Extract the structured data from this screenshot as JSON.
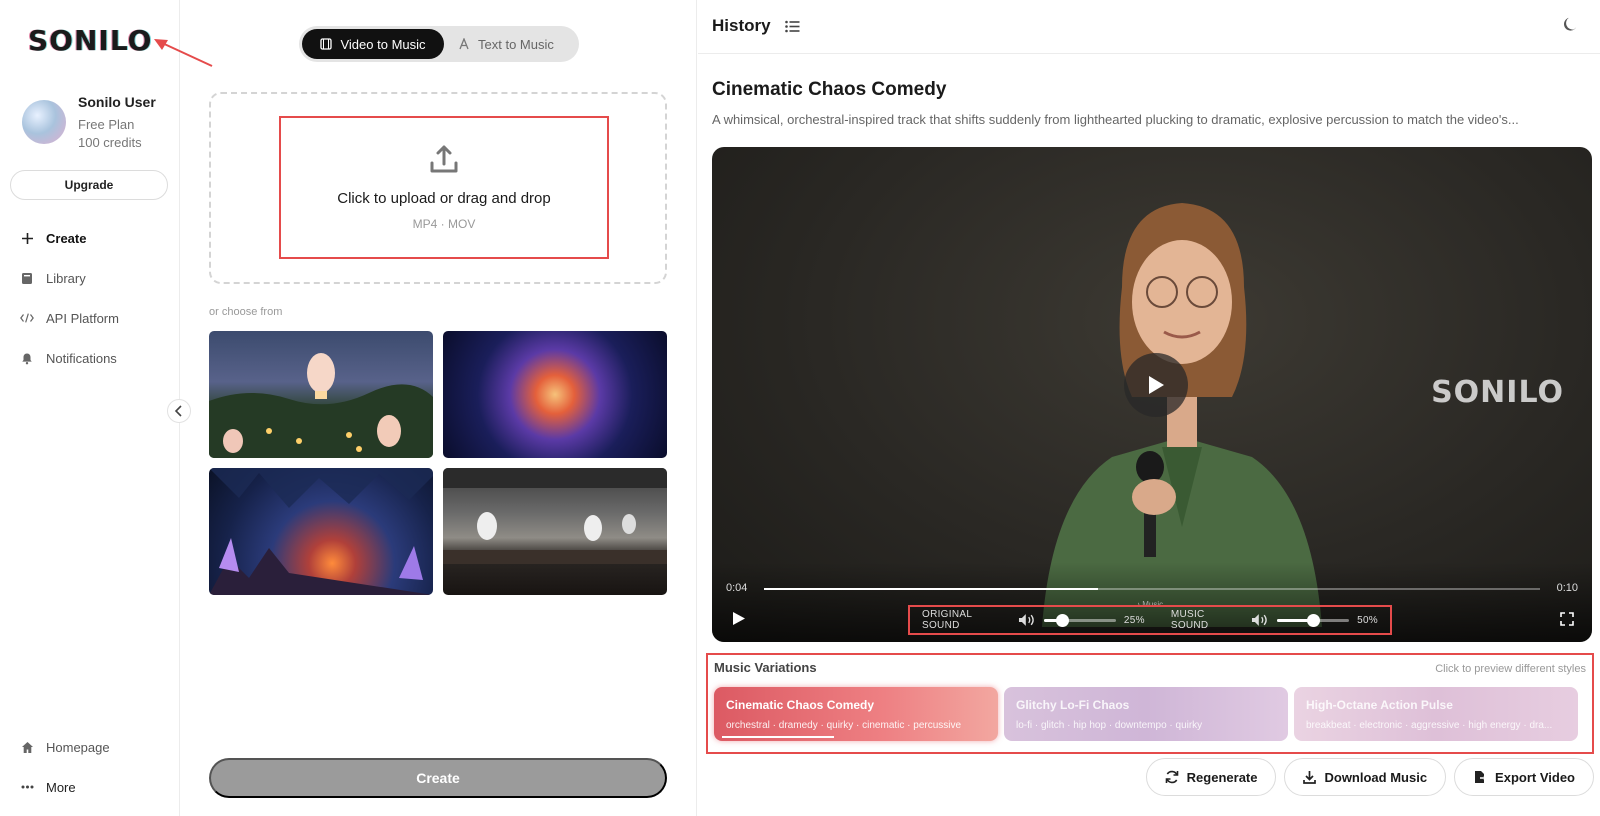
{
  "brand": {
    "logo_text": "SONILO",
    "accent": "#e54b4b"
  },
  "user": {
    "name": "Sonilo User",
    "plan": "Free Plan",
    "credits": "100 credits"
  },
  "sidebar": {
    "upgrade_label": "Upgrade",
    "items": [
      {
        "label": "Create",
        "icon": "plus-icon"
      },
      {
        "label": "Library",
        "icon": "book-icon"
      },
      {
        "label": "API Platform",
        "icon": "code-icon"
      },
      {
        "label": "Notifications",
        "icon": "bell-icon"
      }
    ],
    "bottom_items": [
      {
        "label": "Homepage",
        "icon": "home-icon"
      },
      {
        "label": "More",
        "icon": "more-icon"
      }
    ]
  },
  "composer": {
    "modes": [
      {
        "label": "Video to Music",
        "icon": "film-icon",
        "active": true
      },
      {
        "label": "Text to Music",
        "icon": "text-icon",
        "active": false
      }
    ],
    "upload_title": "Click to upload or drag and drop",
    "upload_formats": "MP4 · MOV",
    "choose_label": "or choose from",
    "samples": [
      "lanterns-thumbnail",
      "nebula-thumbnail",
      "crystal-cave-thumbnail",
      "kitchen-thumbnail"
    ],
    "create_label": "Create"
  },
  "history": {
    "title": "History",
    "track_title": "Cinematic Chaos Comedy",
    "track_desc": "A whimsical, orchestral-inspired track that shifts suddenly from lighthearted plucking to dramatic, explosive percussion to match the video's...",
    "video": {
      "watermark": "SONILO",
      "current_time": "0:04",
      "end_time": "0:10",
      "progress": 0.43,
      "music_tag": "♪ Music",
      "original_sound_label": "ORIGINAL SOUND",
      "original_sound_value": "25%",
      "original_sound_level": 0.25,
      "music_sound_label": "MUSIC SOUND",
      "music_sound_value": "50%",
      "music_sound_level": 0.5
    },
    "variations": {
      "label": "Music Variations",
      "hint": "Click to preview different styles",
      "items": [
        {
          "title": "Cinematic Chaos Comedy",
          "tags": "orchestral · dramedy · quirky · cinematic · percussive"
        },
        {
          "title": "Glitchy Lo-Fi Chaos",
          "tags": "lo-fi · glitch · hip hop · downtempo · quirky"
        },
        {
          "title": "High-Octane Action Pulse",
          "tags": "breakbeat · electronic · aggressive · high energy · dra..."
        }
      ]
    },
    "actions": [
      {
        "label": "Regenerate",
        "icon": "refresh-icon"
      },
      {
        "label": "Download Music",
        "icon": "download-icon"
      },
      {
        "label": "Export Video",
        "icon": "export-icon"
      }
    ]
  }
}
